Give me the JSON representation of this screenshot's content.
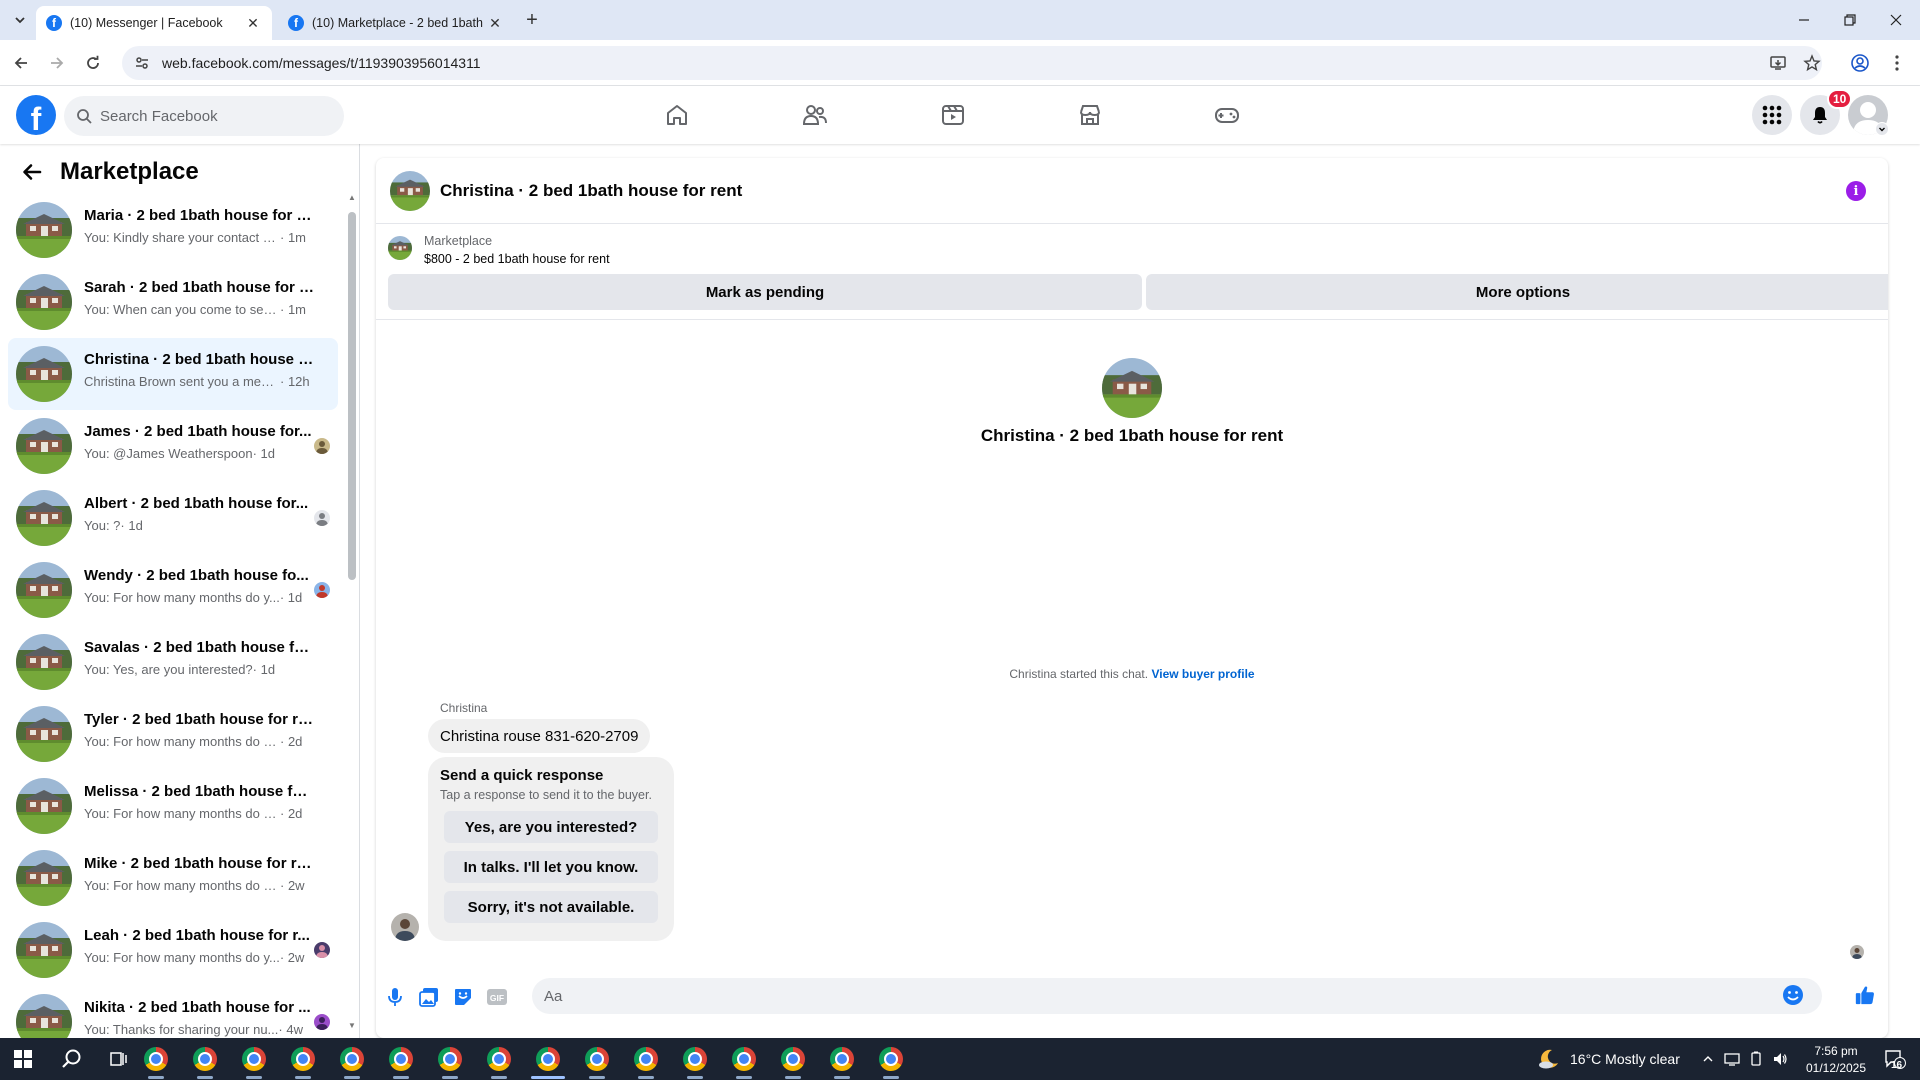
{
  "browser": {
    "tabs": [
      {
        "title": "(10) Messenger | Facebook",
        "active": true
      },
      {
        "title": "(10) Marketplace - 2 bed 1bath",
        "active": false
      }
    ],
    "url": "web.facebook.com/messages/t/1193903956014311"
  },
  "fb": {
    "search_placeholder": "Search Facebook",
    "notification_count": "10",
    "brand_color": "#1877f2"
  },
  "sidebar": {
    "title": "Marketplace",
    "conversations": [
      {
        "title": "Maria · 2 bed 1bath house for rent",
        "preview": "You: Kindly share your contact nu...",
        "time": "· 1m"
      },
      {
        "title": "Sarah · 2 bed 1bath house for rent",
        "preview": "You: When can you come to see th...",
        "time": "· 1m"
      },
      {
        "title": "Christina · 2 bed 1bath house for...",
        "preview": "Christina Brown sent you a messa...",
        "time": "· 12h"
      },
      {
        "title": "James · 2 bed 1bath house for...",
        "preview": "You: @James Weatherspoon",
        "time": "· 1d"
      },
      {
        "title": "Albert · 2 bed 1bath house for...",
        "preview": "You: ?",
        "time": "· 1d"
      },
      {
        "title": "Wendy · 2 bed 1bath house fo...",
        "preview": "You: For how many months do y...",
        "time": "· 1d"
      },
      {
        "title": "Savalas · 2 bed 1bath house for r...",
        "preview": "You: Yes, are you interested?",
        "time": "· 1d"
      },
      {
        "title": "Tyler · 2 bed 1bath house for rent",
        "preview": "You: For how many months do you...",
        "time": "· 2d"
      },
      {
        "title": "Melissa · 2 bed 1bath house for r...",
        "preview": "You: For how many months do you...",
        "time": "· 2d"
      },
      {
        "title": "Mike · 2 bed 1bath house for rent",
        "preview": "You: For how many months do you...",
        "time": "· 2w"
      },
      {
        "title": "Leah · 2 bed 1bath house for r...",
        "preview": "You: For how many months do y...",
        "time": "· 2w"
      },
      {
        "title": "Nikita · 2 bed 1bath house for ...",
        "preview": "You: Thanks for sharing your nu...",
        "time": "· 4w"
      }
    ]
  },
  "chat": {
    "title": "Christina · 2 bed 1bath house for rent",
    "listing": {
      "label": "Marketplace",
      "subtitle": "$800 - 2 bed 1bath house for rent",
      "mark_pending": "Mark as pending",
      "more_options": "More options"
    },
    "intro_title": "Christina · 2 bed 1bath house for rent",
    "started_text": "Christina started this chat.",
    "view_buyer_profile": "View buyer profile",
    "sender_name": "Christina",
    "message": "Christina rouse 831-620-2709",
    "quick_response": {
      "title": "Send a quick response",
      "subtitle": "Tap a response to send it to the buyer.",
      "options": [
        "Yes, are you interested?",
        "In talks. I'll let you know.",
        "Sorry, it's not available."
      ]
    },
    "composer_placeholder": "Aa"
  },
  "taskbar": {
    "weather": "16°C  Mostly clear",
    "time": "7:56 pm",
    "date": "01/12/2025",
    "notifications": "16"
  }
}
